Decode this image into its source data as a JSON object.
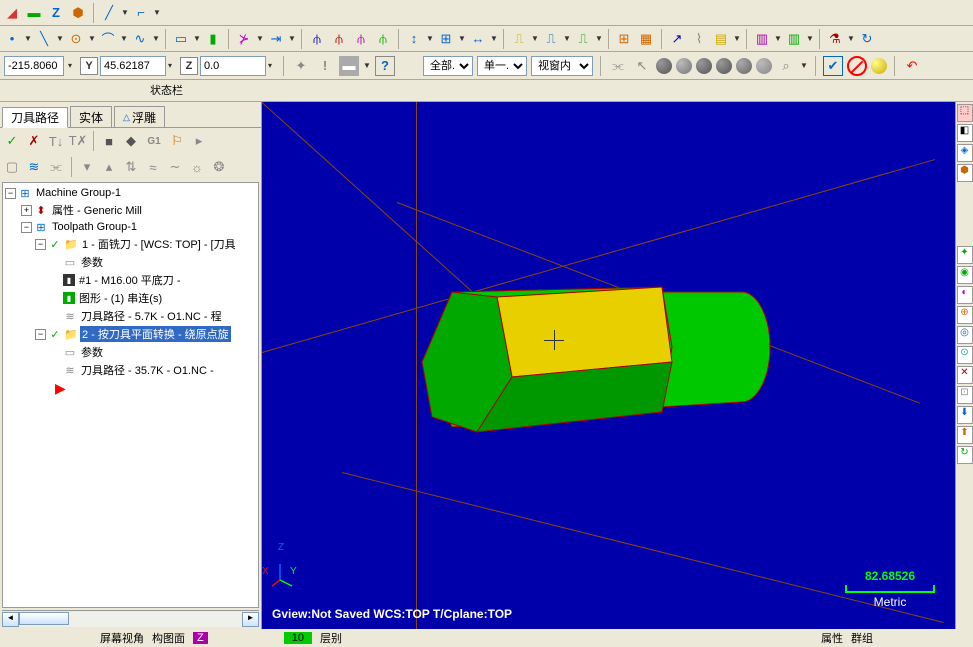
{
  "coords": {
    "x": "-215.8060",
    "y": "45.62187",
    "z": "0.0"
  },
  "statusbar_label": "状态栏",
  "combo1": "全部...",
  "combo2": "单一...",
  "combo3": "视窗内",
  "tabs": {
    "t1": "刀具路径",
    "t2": "实体",
    "t3": "浮雕"
  },
  "g1_label": "G1",
  "tree": {
    "root": "Machine Group-1",
    "prop": "属性 - Generic Mill",
    "tpg": "Toolpath Group-1",
    "op1": "1 - 面铣刀 - [WCS: TOP] - [刀具",
    "op1_param": "参数",
    "op1_tool": "#1 - M16.00 平底刀 -",
    "op1_geom": "图形 - (1) 串连(s)",
    "op1_path": "刀具路径 - 5.7K - O1.NC - 程",
    "op2": "2 - 按刀具平面转换 - 绕原点旋",
    "op2_param": "参数",
    "op2_path": "刀具路径 - 35.7K - O1.NC -"
  },
  "viewport": {
    "status": "Gview:Not Saved  WCS:TOP  T/Cplane:TOP",
    "scale": "82.68526",
    "unit": "Metric",
    "axes": {
      "x": "X",
      "y": "Y",
      "z": "Z"
    }
  },
  "bottom": {
    "b1": "屏幕视角",
    "b2": "构图面",
    "b3": "层别",
    "b4": "属性",
    "b5": "群组",
    "num": "10"
  }
}
